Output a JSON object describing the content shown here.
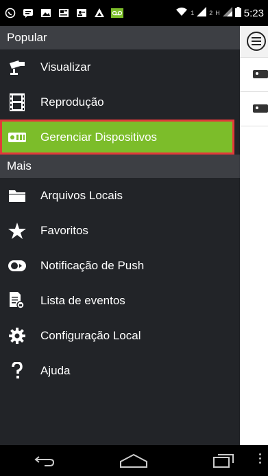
{
  "status_bar": {
    "time": "5:23",
    "sim1": "1",
    "sim2": "2",
    "network": "H",
    "icons": [
      "whatsapp-icon",
      "chat-icon",
      "image-icon",
      "news-icon",
      "contacts-icon",
      "drive-icon",
      "voicemail-icon",
      "wifi-icon",
      "signal-icon",
      "battery-icon"
    ]
  },
  "drawer": {
    "section_popular": "Popular",
    "section_more": "Mais",
    "popular_items": [
      {
        "label": "Visualizar",
        "icon": "camera-icon"
      },
      {
        "label": "Reprodução",
        "icon": "film-icon"
      },
      {
        "label": "Gerenciar Dispositivos",
        "icon": "device-icon",
        "active": true
      }
    ],
    "more_items": [
      {
        "label": "Arquivos Locais",
        "icon": "folder-icon"
      },
      {
        "label": "Favoritos",
        "icon": "star-icon"
      },
      {
        "label": "Notificação de Push",
        "icon": "toggle-icon"
      },
      {
        "label": "Lista de eventos",
        "icon": "event-list-icon"
      },
      {
        "label": "Configuração Local",
        "icon": "gear-icon"
      },
      {
        "label": "Ajuda",
        "icon": "help-icon"
      }
    ]
  },
  "colors": {
    "drawer_bg": "#222428",
    "section_bg": "#3d3f44",
    "active_bg": "#7cbd2a",
    "active_border": "#e23a3a"
  },
  "nav_bar": {
    "buttons": [
      "back-icon",
      "home-icon",
      "recents-icon",
      "more-icon"
    ]
  }
}
